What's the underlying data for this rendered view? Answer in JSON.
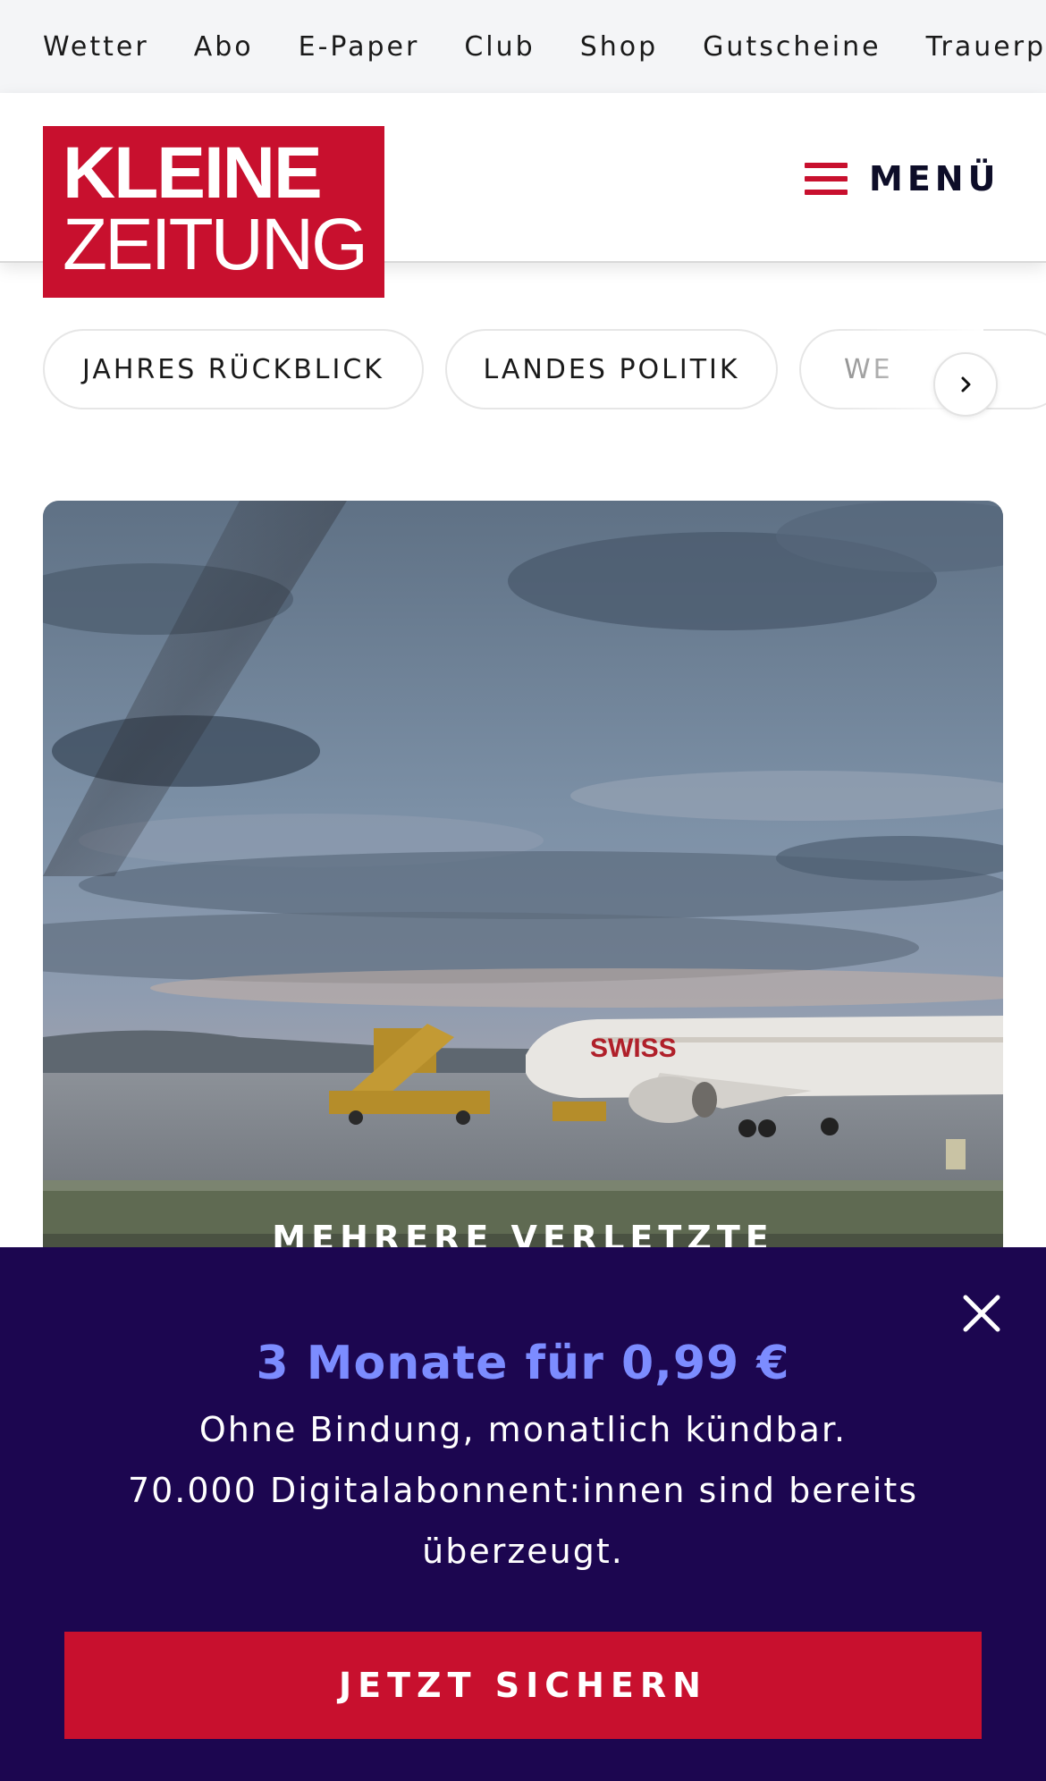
{
  "top_nav": {
    "items": [
      "Wetter",
      "Abo",
      "E-Paper",
      "Club",
      "Shop",
      "Gutscheine",
      "Trauerp"
    ]
  },
  "header": {
    "logo_line1": "KLEINE",
    "logo_line2": "ZEITUNG",
    "menu_label": "MENÜ",
    "brand_color": "#c8102e"
  },
  "topics": {
    "pills": [
      "JAHRES RÜCKBLICK",
      "LANDES POLITIK",
      "WE"
    ],
    "next_icon": "chevron-right-icon"
  },
  "article": {
    "kicker": "MEHRERE VERLETZTE"
  },
  "promo": {
    "headline": "3 Monate für 0,99 €",
    "line1": "Ohne Bindung, monatlich kündbar.",
    "line2": "70.000 Digitalabonnent:innen sind bereits",
    "line3": "überzeugt.",
    "cta_label": "JETZT SICHERN",
    "close_icon": "close-icon",
    "background_color": "#1c0650",
    "headline_color": "#7c8cff"
  }
}
